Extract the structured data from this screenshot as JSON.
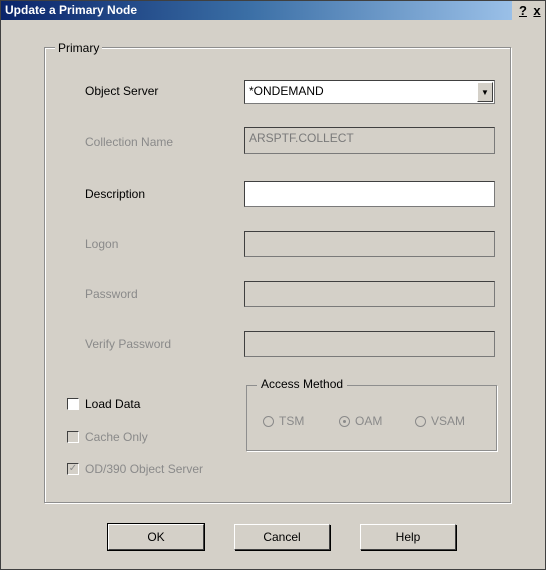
{
  "window": {
    "title": "Update a Primary Node",
    "help_button": "?",
    "close_button": "x"
  },
  "group": {
    "legend": "Primary"
  },
  "fields": {
    "object_server": {
      "label": "Object Server",
      "value": "*ONDEMAND"
    },
    "collection_name": {
      "label": "Collection Name",
      "value": "ARSPTF.COLLECT"
    },
    "description": {
      "label": "Description",
      "value": ""
    },
    "logon": {
      "label": "Logon",
      "value": ""
    },
    "password": {
      "label": "Password",
      "value": ""
    },
    "verify_password": {
      "label": "Verify Password",
      "value": ""
    }
  },
  "checkboxes": {
    "load_data": {
      "label": "Load Data",
      "checked": false
    },
    "cache_only": {
      "label": "Cache Only",
      "checked": false
    },
    "od390_object_server": {
      "label": "OD/390 Object Server",
      "checked": true
    }
  },
  "access_method": {
    "legend": "Access Method",
    "options": [
      "TSM",
      "OAM",
      "VSAM"
    ],
    "selected": "OAM"
  },
  "buttons": {
    "ok": "OK",
    "cancel": "Cancel",
    "help": "Help"
  },
  "icons": {
    "dropdown": "chevron-down-icon",
    "check": "checkmark-icon"
  }
}
